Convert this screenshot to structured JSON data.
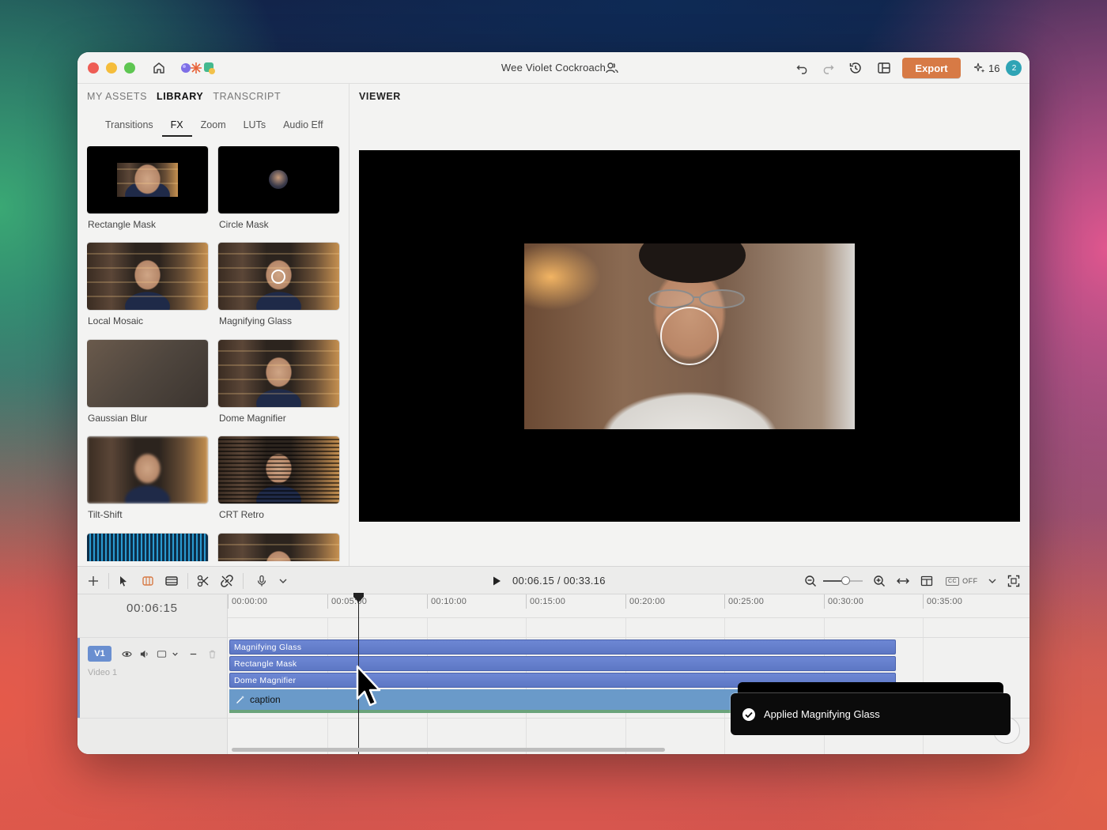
{
  "window": {
    "title": "Wee Violet Cockroach",
    "export_label": "Export",
    "credits": "16",
    "notification_count": "2"
  },
  "left_panel": {
    "main_tabs": [
      {
        "label": "MY ASSETS",
        "active": false
      },
      {
        "label": "LIBRARY",
        "active": true
      },
      {
        "label": "TRANSCRIPT",
        "active": false
      }
    ],
    "sub_tabs": [
      {
        "label": "Transitions",
        "active": false
      },
      {
        "label": "FX",
        "active": true
      },
      {
        "label": "Zoom",
        "active": false
      },
      {
        "label": "LUTs",
        "active": false
      },
      {
        "label": "Audio Eff",
        "active": false
      }
    ],
    "fx_items": [
      {
        "label": "Rectangle Mask"
      },
      {
        "label": "Circle Mask"
      },
      {
        "label": "Local Mosaic"
      },
      {
        "label": "Magnifying Glass"
      },
      {
        "label": "Gaussian Blur"
      },
      {
        "label": "Dome Magnifier"
      },
      {
        "label": "Tilt-Shift"
      },
      {
        "label": "CRT Retro"
      }
    ]
  },
  "viewer": {
    "label": "VIEWER"
  },
  "toolbar": {
    "timecode": "00:06.15 / 00:33.16",
    "cc_label": "CC",
    "cc_state": "OFF",
    "zoom_fraction": 0.56
  },
  "timeline": {
    "playhead_time": "00:06:15",
    "ruler_labels": [
      "00:00:00",
      "00:05:00",
      "00:10:00",
      "00:15:00",
      "00:20:00",
      "00:25:00",
      "00:30:00",
      "00:35:00"
    ],
    "track": {
      "badge": "V1",
      "name": "Video 1"
    },
    "clips": [
      {
        "label": "Magnifying Glass"
      },
      {
        "label": "Rectangle Mask"
      },
      {
        "label": "Dome Magnifier"
      }
    ],
    "caption_clip": "caption"
  },
  "toast": {
    "message": "Applied Magnifying Glass"
  },
  "colors": {
    "accent_export": "#d77a45",
    "clip_blue": "#6d87d4",
    "caption_blue": "#6a9ac9",
    "badge_teal": "#2fa4b5"
  }
}
